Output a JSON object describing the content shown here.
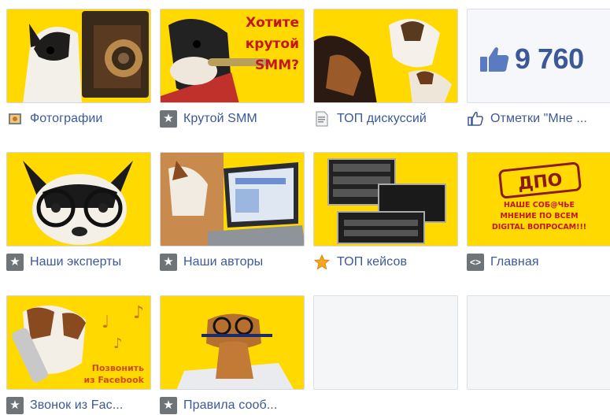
{
  "colors": {
    "link": "#3b5998",
    "thumb_bg": "#ffd700",
    "accent_red": "#c4161c"
  },
  "tabs": [
    {
      "label": "Фотографии",
      "icon": "photo-icon"
    },
    {
      "label": "Крутой SMM",
      "icon": "star-icon",
      "overlay": [
        "Хотите",
        "крутой",
        "SMM?"
      ]
    },
    {
      "label": "ТОП дискуссий",
      "icon": "document-icon"
    },
    {
      "label": "Отметки \"Мне ...",
      "icon": "like-icon",
      "likes_count": "9 760"
    },
    {
      "label": "Наши эксперты",
      "icon": "star-icon"
    },
    {
      "label": "Наши авторы",
      "icon": "star-icon"
    },
    {
      "label": "ТОП кейсов",
      "icon": "star-badge-icon"
    },
    {
      "label": "Главная",
      "icon": "code-icon",
      "stamp": "ДПО",
      "overlay": [
        "НАШЕ СОБ@ЧЬЕ",
        "МНЕНИЕ ПО ВСЕМ",
        "DIGITAL ВОПРОСАМ!!!"
      ]
    },
    {
      "label": "Звонок из Fac...",
      "icon": "star-icon",
      "overlay": [
        "Позвонить",
        "из Facebook"
      ]
    },
    {
      "label": "Правила сооб...",
      "icon": "star-icon"
    }
  ]
}
